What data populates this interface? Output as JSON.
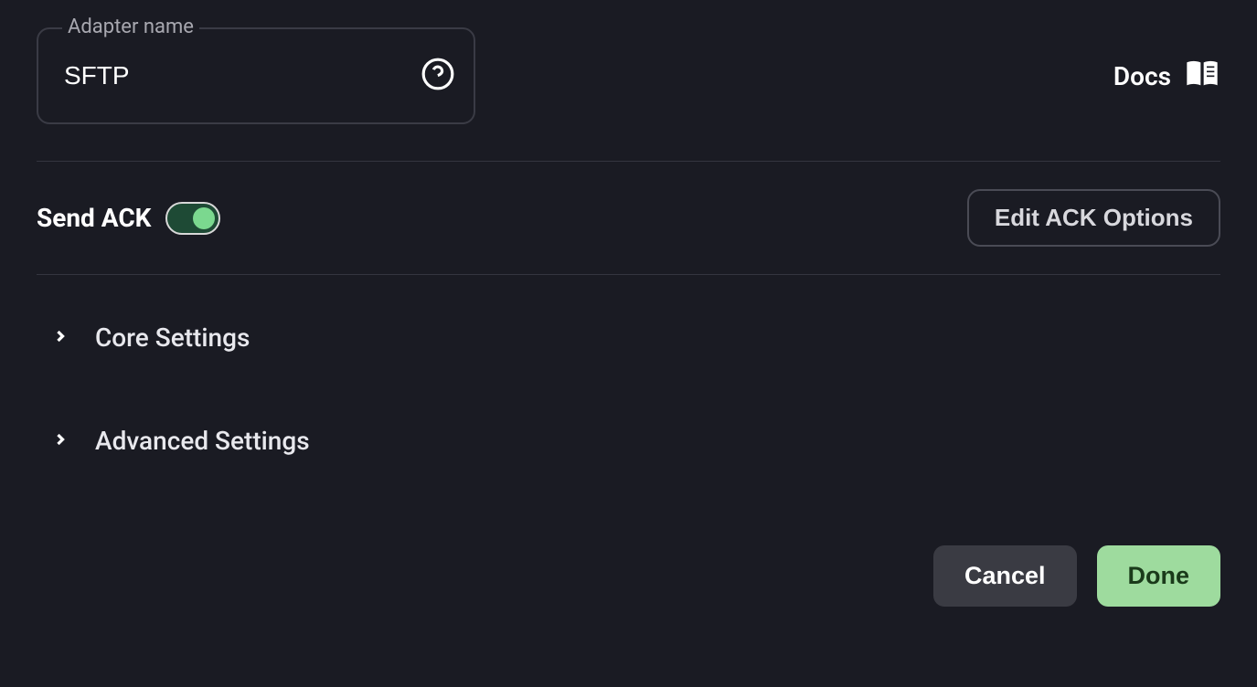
{
  "adapterName": {
    "label": "Adapter name",
    "value": "SFTP"
  },
  "docs": {
    "label": "Docs"
  },
  "ack": {
    "label": "Send ACK",
    "enabled": true,
    "editLabel": "Edit ACK Options"
  },
  "sections": {
    "core": "Core Settings",
    "advanced": "Advanced Settings"
  },
  "buttons": {
    "cancel": "Cancel",
    "done": "Done"
  }
}
